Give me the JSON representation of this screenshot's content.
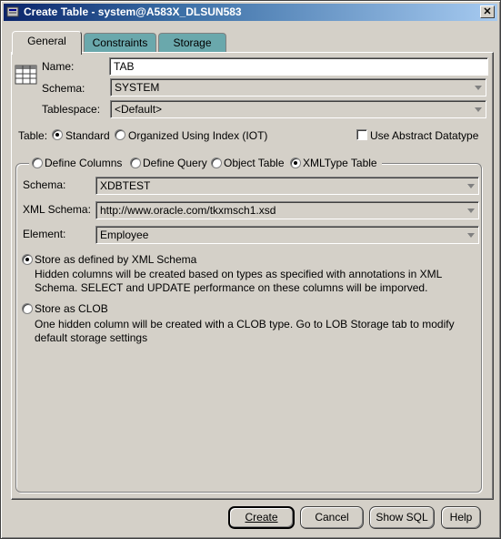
{
  "window": {
    "title": "Create Table - system@A583X_DLSUN583",
    "close_glyph": "✕"
  },
  "tabs": [
    {
      "label": "General",
      "active": true
    },
    {
      "label": "Constraints",
      "active": false
    },
    {
      "label": "Storage",
      "active": false
    }
  ],
  "general": {
    "name_label": "Name:",
    "name_value": "TAB",
    "schema_label": "Schema:",
    "schema_value": "SYSTEM",
    "tablespace_label": "Tablespace:",
    "tablespace_value": "<Default>",
    "table_label": "Table:",
    "table_type_options": [
      {
        "label": "Standard",
        "selected": true
      },
      {
        "label": "Organized Using Index (IOT)",
        "selected": false
      }
    ],
    "abstract_datatype_label": "Use Abstract Datatype",
    "abstract_datatype_checked": false
  },
  "definition": {
    "options": [
      {
        "label": "Define Columns",
        "selected": false
      },
      {
        "label": "Define Query",
        "selected": false
      },
      {
        "label": "Object Table",
        "selected": false
      },
      {
        "label": "XMLType Table",
        "selected": true
      }
    ],
    "schema_label": "Schema:",
    "schema_value": "XDBTEST",
    "xml_schema_label": "XML Schema:",
    "xml_schema_value": "http://www.oracle.com/tkxmsch1.xsd",
    "element_label": "Element:",
    "element_value": "Employee",
    "storage_options": [
      {
        "label": "Store as defined by XML Schema",
        "selected": true,
        "description_line1": "Hidden columns will be created based on types as specified with annotations in XML",
        "description_line2": "Schema. SELECT and UPDATE performance on these columns will be imporved."
      },
      {
        "label": "Store as CLOB",
        "selected": false,
        "description_line1": "One hidden column will be created with a CLOB type. Go to LOB Storage tab to modify",
        "description_line2": "default storage settings"
      }
    ]
  },
  "buttons": {
    "create": "Create",
    "cancel": "Cancel",
    "show_sql": "Show SQL",
    "help": "Help"
  },
  "colors": {
    "dialog_bg": "#d4d0c8",
    "titlebar_start": "#0a246a",
    "titlebar_end": "#a6caf0",
    "inactive_tab": "#6aa8ac"
  }
}
